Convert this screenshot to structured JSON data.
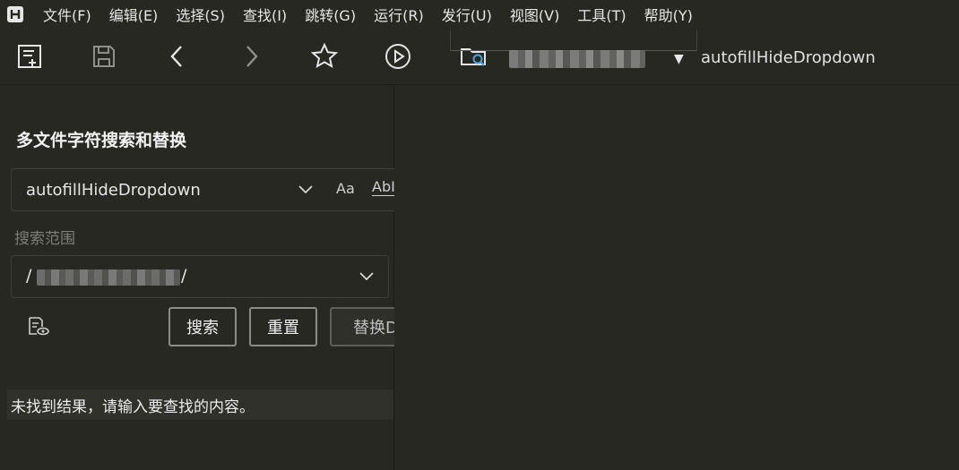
{
  "menu": [
    "文件(F)",
    "编辑(E)",
    "选择(S)",
    "查找(I)",
    "跳转(G)",
    "运行(R)",
    "发行(U)",
    "视图(V)",
    "工具(T)",
    "帮助(Y)"
  ],
  "toolbar": {
    "search_text": "autofillHideDropdown",
    "buttons": [
      "new-file-icon",
      "save-icon",
      "back-icon",
      "forward-icon",
      "star-icon",
      "run-icon",
      "folder-search-icon"
    ]
  },
  "panel": {
    "title": "多文件字符搜索和替换",
    "search_value": "autofillHideDropdown",
    "match_case_label": "Aa",
    "whole_word_label": "AbI",
    "scope_label": "搜索范围",
    "scope_prefix": "/",
    "scope_suffix": "/",
    "search_button": "搜索",
    "reset_button": "重置",
    "replace_button": "替换D",
    "result_message": "未找到结果，请输入要查找的内容。"
  },
  "colors": {
    "background": "#272822",
    "text": "#d6d6d6",
    "muted": "#7c7c78",
    "border": "#3e3f39"
  }
}
